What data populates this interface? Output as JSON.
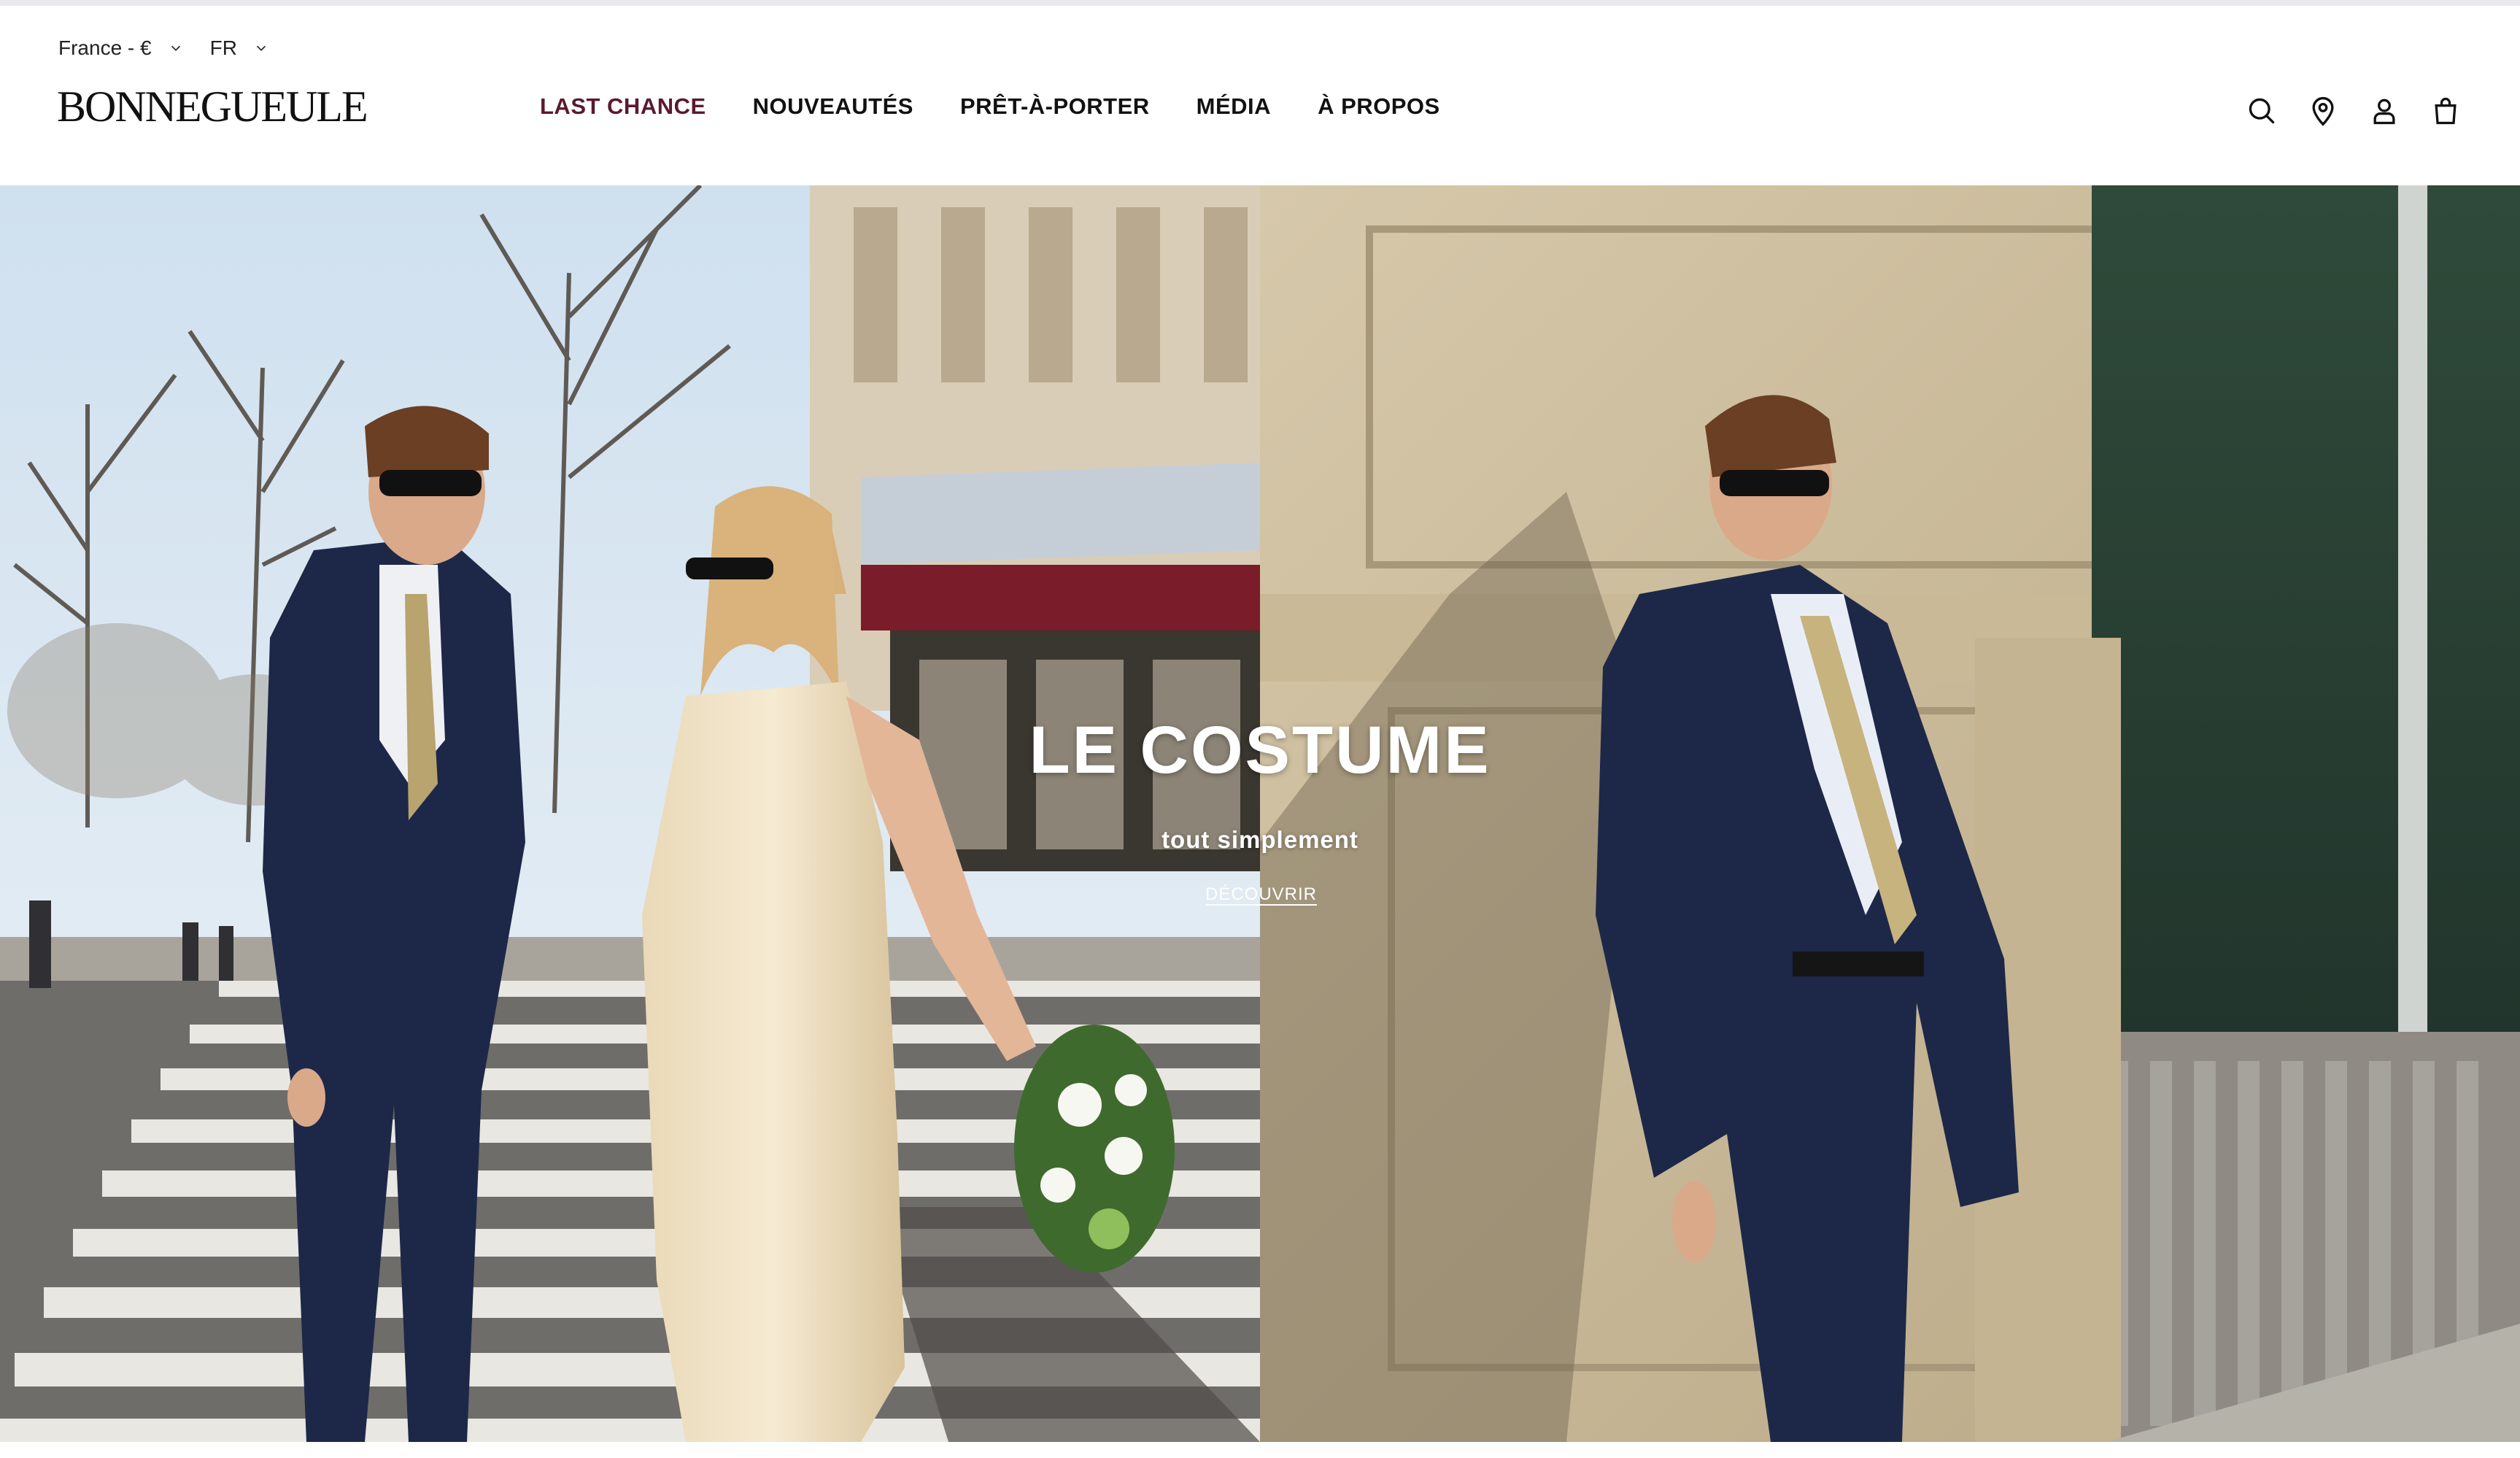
{
  "locale": {
    "country": "France - €",
    "language": "FR"
  },
  "brand": {
    "logo_text": "BONNEGUEULE"
  },
  "nav": {
    "items": [
      {
        "label": "LAST CHANCE",
        "accent": true
      },
      {
        "label": "NOUVEAUTÉS",
        "accent": false
      },
      {
        "label": "PRÊT-À-PORTER",
        "accent": false
      },
      {
        "label": "MÉDIA",
        "accent": false
      },
      {
        "label": "À PROPOS",
        "accent": false
      }
    ]
  },
  "header_icons": [
    "search-icon",
    "store-locator-icon",
    "account-icon",
    "cart-icon"
  ],
  "hero": {
    "title": "LE COSTUME",
    "subtitle": "tout simplement",
    "cta": "DÉCOUVRIR"
  },
  "colors": {
    "accent": "#5a1a2e",
    "text": "#111111",
    "suit_navy": "#1d2848"
  }
}
